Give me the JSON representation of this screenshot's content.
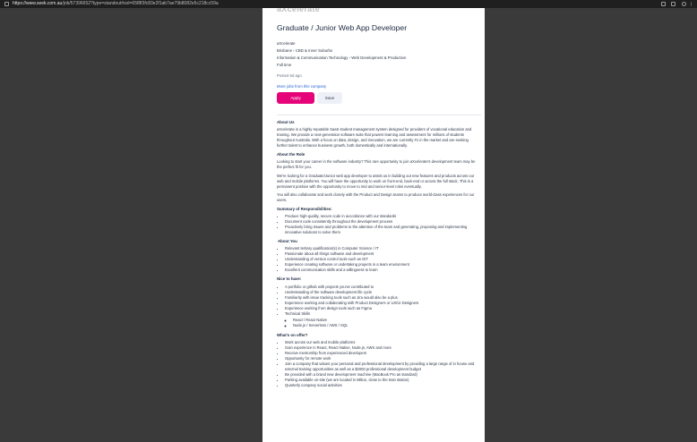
{
  "browser": {
    "url_host": "https://www.seek.com.au",
    "url_path": "/job/57396652?type=standout#sol=65f8f3fc83e2f1ab7ae79b8082e5c218cc59a"
  },
  "job": {
    "company_logo_text": "aXcelerate",
    "title": "Graduate / Junior Web App Developer",
    "company": "aXcelerate",
    "location": "Brisbane  ›  CBD & Inner Suburbs",
    "classification": "Information & Communication Technology  ›  Web Development & Production",
    "work_type": "Full time",
    "posted": "Posted 6d ago",
    "more_jobs": "More jobs from this company",
    "apply_label": "Apply",
    "save_label": "Save"
  },
  "description": {
    "about_us_heading": "About Us",
    "about_us_text": "aXcelerate is a highly-reputable SaaS student management system designed for providers of vocational education and training. We provide a next-generation software suite that powers learning and assessment for millions of students throughout Australia. With a focus on data, design, and innovation, we are currently #1 in the market and are seeking further talent to enhance business growth, both domestically and internationally.",
    "about_role_heading": "About the Role",
    "role_p1": "Looking to start your career in the software industry? This rare opportunity to join aXcelerate's development team may be the perfect fit for you.",
    "role_p2": "We're looking for a Graduate/Junior web app developer to assist us in building out new features and products across our web and mobile platforms. You will have the opportunity to work on front-end, back-end or across the full stack. This is a permanent position with the opportunity to move to mid and senior-level roles eventually.",
    "role_p3": "You will also collaborate and work closely with the Product and Design teams to produce world-class experiences for our users.",
    "summary_heading": "Summary of Responsibilities:",
    "responsibilities": [
      "Produce high-quality, secure code in accordance with our standards",
      "Document code consistently throughout the development process",
      "Proactively bring issues and problems to the attention of the team and generating, proposing and implementing innovative solutions to solve them"
    ],
    "about_you_heading": "About You",
    "about_you": [
      "Relevant tertiary qualification(s) in Computer Science / IT",
      "Passionate about all things software and development",
      "Understanding of version control tools such as GIT",
      "Experience creating software or undertaking projects in a team environment",
      "Excellent communication skills and a willingness to learn"
    ],
    "nice_heading": "Nice to have:",
    "nice": [
      "A portfolio or github with projects you've contributed to",
      "Understanding of the software development life cycle",
      "Familiarity with issue tracking tools such as Jira would also be a plus",
      "Experience working and collaborating with Product Designers or UX/UI Designers",
      "Experience working from design tools such as Figma",
      "Technical Skills"
    ],
    "tech_skills": [
      "React / React Native",
      "Node.js / Serverless / AWS / SQL"
    ],
    "offer_heading": "What's on offer?",
    "offer": [
      "Work across our web and mobile platforms",
      "Gain experience in React, React Native, Node.js, AWS and more",
      "Receive mentorship from experienced developers",
      "Opportunity for remote work",
      "Join a company that values your personal and professional development by providing a large range of in house and external training opportunities as well as a $2000 professional development budget",
      "Be provided with a brand new development machine (MacBook Pro as standard)",
      "Parking available on-site (we are located in Milton, close to the train station)",
      "Quarterly company social activities"
    ]
  }
}
